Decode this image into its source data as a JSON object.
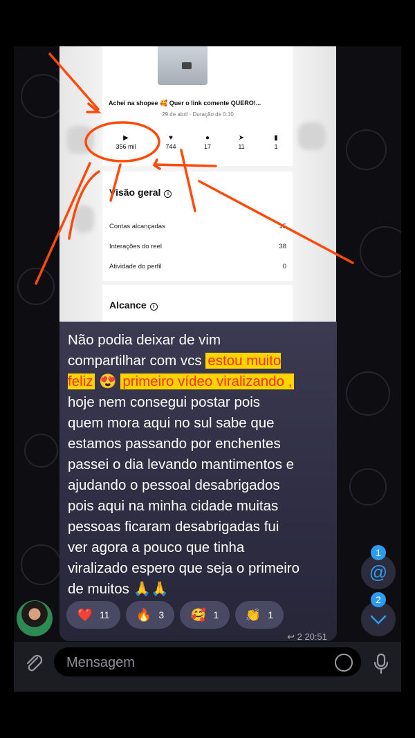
{
  "post": {
    "title": "Achei na shopee 🥰 Quer o link comente QUERO!...",
    "date": "29 de abril · Duração de 0:10",
    "metrics": [
      {
        "icon": "play-icon",
        "value": "356 mil"
      },
      {
        "icon": "heart-icon",
        "value": "744"
      },
      {
        "icon": "comment-icon",
        "value": "17"
      },
      {
        "icon": "send-icon",
        "value": "11"
      },
      {
        "icon": "bookmark-icon",
        "value": "1"
      }
    ]
  },
  "overview": {
    "title": "Visão geral",
    "rows": [
      {
        "label": "Contas alcançadas",
        "value": "15"
      },
      {
        "label": "Interações do reel",
        "value": "38"
      },
      {
        "label": "Atividade do perfil",
        "value": "0"
      }
    ]
  },
  "reach": {
    "title": "Alcance"
  },
  "message": {
    "text_a": "Não podia deixar de vim\ncompartilhar com vcs ",
    "highlight_1": "estou muito\nfeliz",
    "emoji_1": " 😍 ",
    "highlight_2": "primeiro vídeo viralizando ,",
    "text_b": "\nhoje nem consegui postar  pois\nquem mora aqui no sul sabe que\nestamos passando por enchentes\npassei o dia levando mantimentos e\najudando o pessoal desabrigados\npois aqui na minha cidade muitas\npessoas ficaram desabrigadas fui\nver agora a pouco que tinha\nviralizado espero que seja o primeiro\nde muitos 🙏🙏",
    "reactions": [
      {
        "emoji": "❤️",
        "count": "11"
      },
      {
        "emoji": "🔥",
        "count": "3"
      },
      {
        "emoji": "🥰",
        "count": "1"
      },
      {
        "emoji": "👏",
        "count": "1"
      }
    ],
    "meta": "↩ 2  20:51"
  },
  "fabs": {
    "mention_badge": "1",
    "mention_icon": "@",
    "down_badge": "2",
    "down_icon": "⌄"
  },
  "input": {
    "placeholder": "Mensagem"
  },
  "colors": {
    "annotation": "#ff4a0a",
    "highlight": "#ffd400",
    "accent": "#2e9bf1",
    "bubble": "#34334b"
  }
}
